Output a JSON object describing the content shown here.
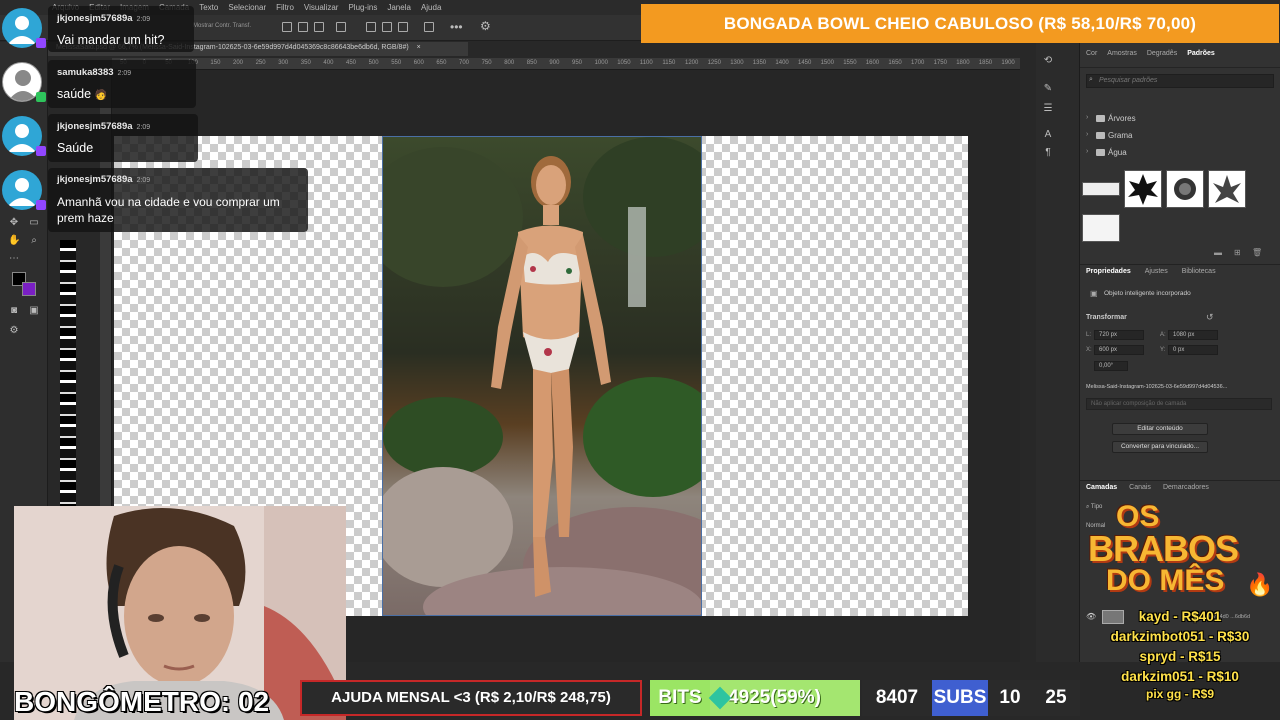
{
  "menubar": {
    "items": [
      "Arquivo",
      "Editar",
      "Imagem",
      "Camada",
      "Texto",
      "Selecionar",
      "Filtro",
      "Visualizar",
      "Plug-ins",
      "Janela",
      "Ajuda"
    ]
  },
  "optionsbar": {
    "transform_controls": "Mostrar Contr. Transf."
  },
  "document_tab": {
    "title": "MelissaSaid.psd @ 66,7% (Melissa-Said-Instagram-102625-03-6e59d997d4d045369c8c86643be6db6d, RGB/8#)",
    "close": "×"
  },
  "ruler": {
    "ticks": [
      "50",
      "0",
      "50",
      "100",
      "150",
      "200",
      "250",
      "300",
      "350",
      "400",
      "450",
      "500",
      "550",
      "600",
      "650",
      "700",
      "750",
      "800",
      "850",
      "900",
      "950",
      "1000",
      "1050",
      "1100",
      "1150",
      "1200",
      "1250",
      "1300",
      "1350",
      "1400",
      "1450",
      "1500",
      "1550",
      "1600",
      "1650",
      "1700",
      "1750",
      "1800",
      "1850",
      "1900"
    ]
  },
  "chat": [
    {
      "user": "jkjonesjm57689a",
      "time": "2:09",
      "text": "Vai mandar um hit?"
    },
    {
      "user": "samuka8383",
      "time": "2:09",
      "text": "saúde"
    },
    {
      "user": "jkjonesjm57689a",
      "time": "2:09",
      "text": "Saúde"
    },
    {
      "user": "jkjonesjm57689a",
      "time": "2:09",
      "text": "Amanhã vou na cidade e vou comprar um prem haze"
    }
  ],
  "top_banner": "BONGADA BOWL CHEIO CABULOSO (R$ 58,10/R$ 70,00)",
  "patterns_panel": {
    "tabs": [
      "Cor",
      "Amostras",
      "Degradês",
      "Padrões"
    ],
    "active_tab": "Padrões",
    "search_placeholder": "Pesquisar padrões",
    "folders": [
      "Árvores",
      "Grama",
      "Água"
    ]
  },
  "properties_panel": {
    "tabs": [
      "Propriedades",
      "Ajustes",
      "Bibliotecas"
    ],
    "type": "Objeto inteligente incorporado",
    "section": "Transformar",
    "w_label": "L:",
    "w": "720 px",
    "h_label": "A:",
    "h": "1080 px",
    "x_label": "X:",
    "x": "600 px",
    "y_label": "Y:",
    "y": "0 px",
    "angle": "0,00°",
    "filename": "Melissa-Said-Instagram-102625-03-6e59d997d4d04536...",
    "layer_comp": "Não aplicar composição de camada",
    "edit_button": "Editar conteúdo",
    "convert_button": "Converter para vinculado..."
  },
  "layers_panel": {
    "tabs": [
      "Camadas",
      "Canais",
      "Demarcadores"
    ],
    "filter": "Tipo",
    "blend": "Normal",
    "layer_name": "6e59d997d4d0 ...6db6d"
  },
  "overlay": {
    "bongometro": "BONGÔMETRO: 02",
    "ajuda": "AJUDA MENSAL <3 (R$ 2,10/R$ 248,75)",
    "bits_label": "BITS",
    "bits_value": "4925(59%)",
    "count": "8407",
    "subs_label": "SUBS",
    "subs_a": "10",
    "subs_b": "25",
    "brabos_title": [
      "OS",
      "BRABOS",
      "DO MÊS"
    ],
    "top_donors": [
      "kayd - R$401",
      "darkzimbot051 - R$30",
      "spryd - R$15",
      "darkzim051 - R$10",
      "pix gg - R$9"
    ]
  }
}
